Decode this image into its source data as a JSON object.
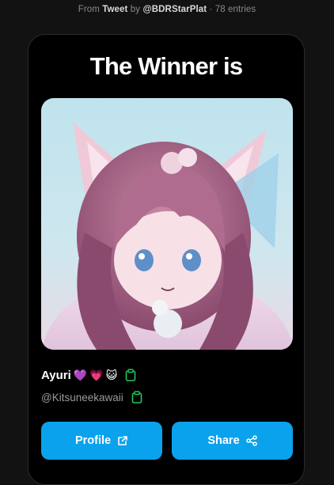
{
  "source": {
    "prefix": "From",
    "platform": "Tweet",
    "by": "by",
    "author": "@BDRStarPlat",
    "separator": "·",
    "entries": "78 entries"
  },
  "card": {
    "title": "The Winner is",
    "winner": {
      "name": "Ayuri",
      "emojis": [
        "💜",
        "💗",
        "😺"
      ],
      "handle": "@Kitsuneekawaii"
    },
    "buttons": {
      "profile_label": "Profile",
      "share_label": "Share"
    }
  },
  "colors": {
    "background": "#121212",
    "card": "#000000",
    "accent_button": "#0aa2ec",
    "copy_icon": "#22c55e",
    "muted_text": "#9a9a9a"
  },
  "icons": {
    "copy": "clipboard-icon",
    "external": "external-link-icon",
    "share": "share-icon"
  }
}
